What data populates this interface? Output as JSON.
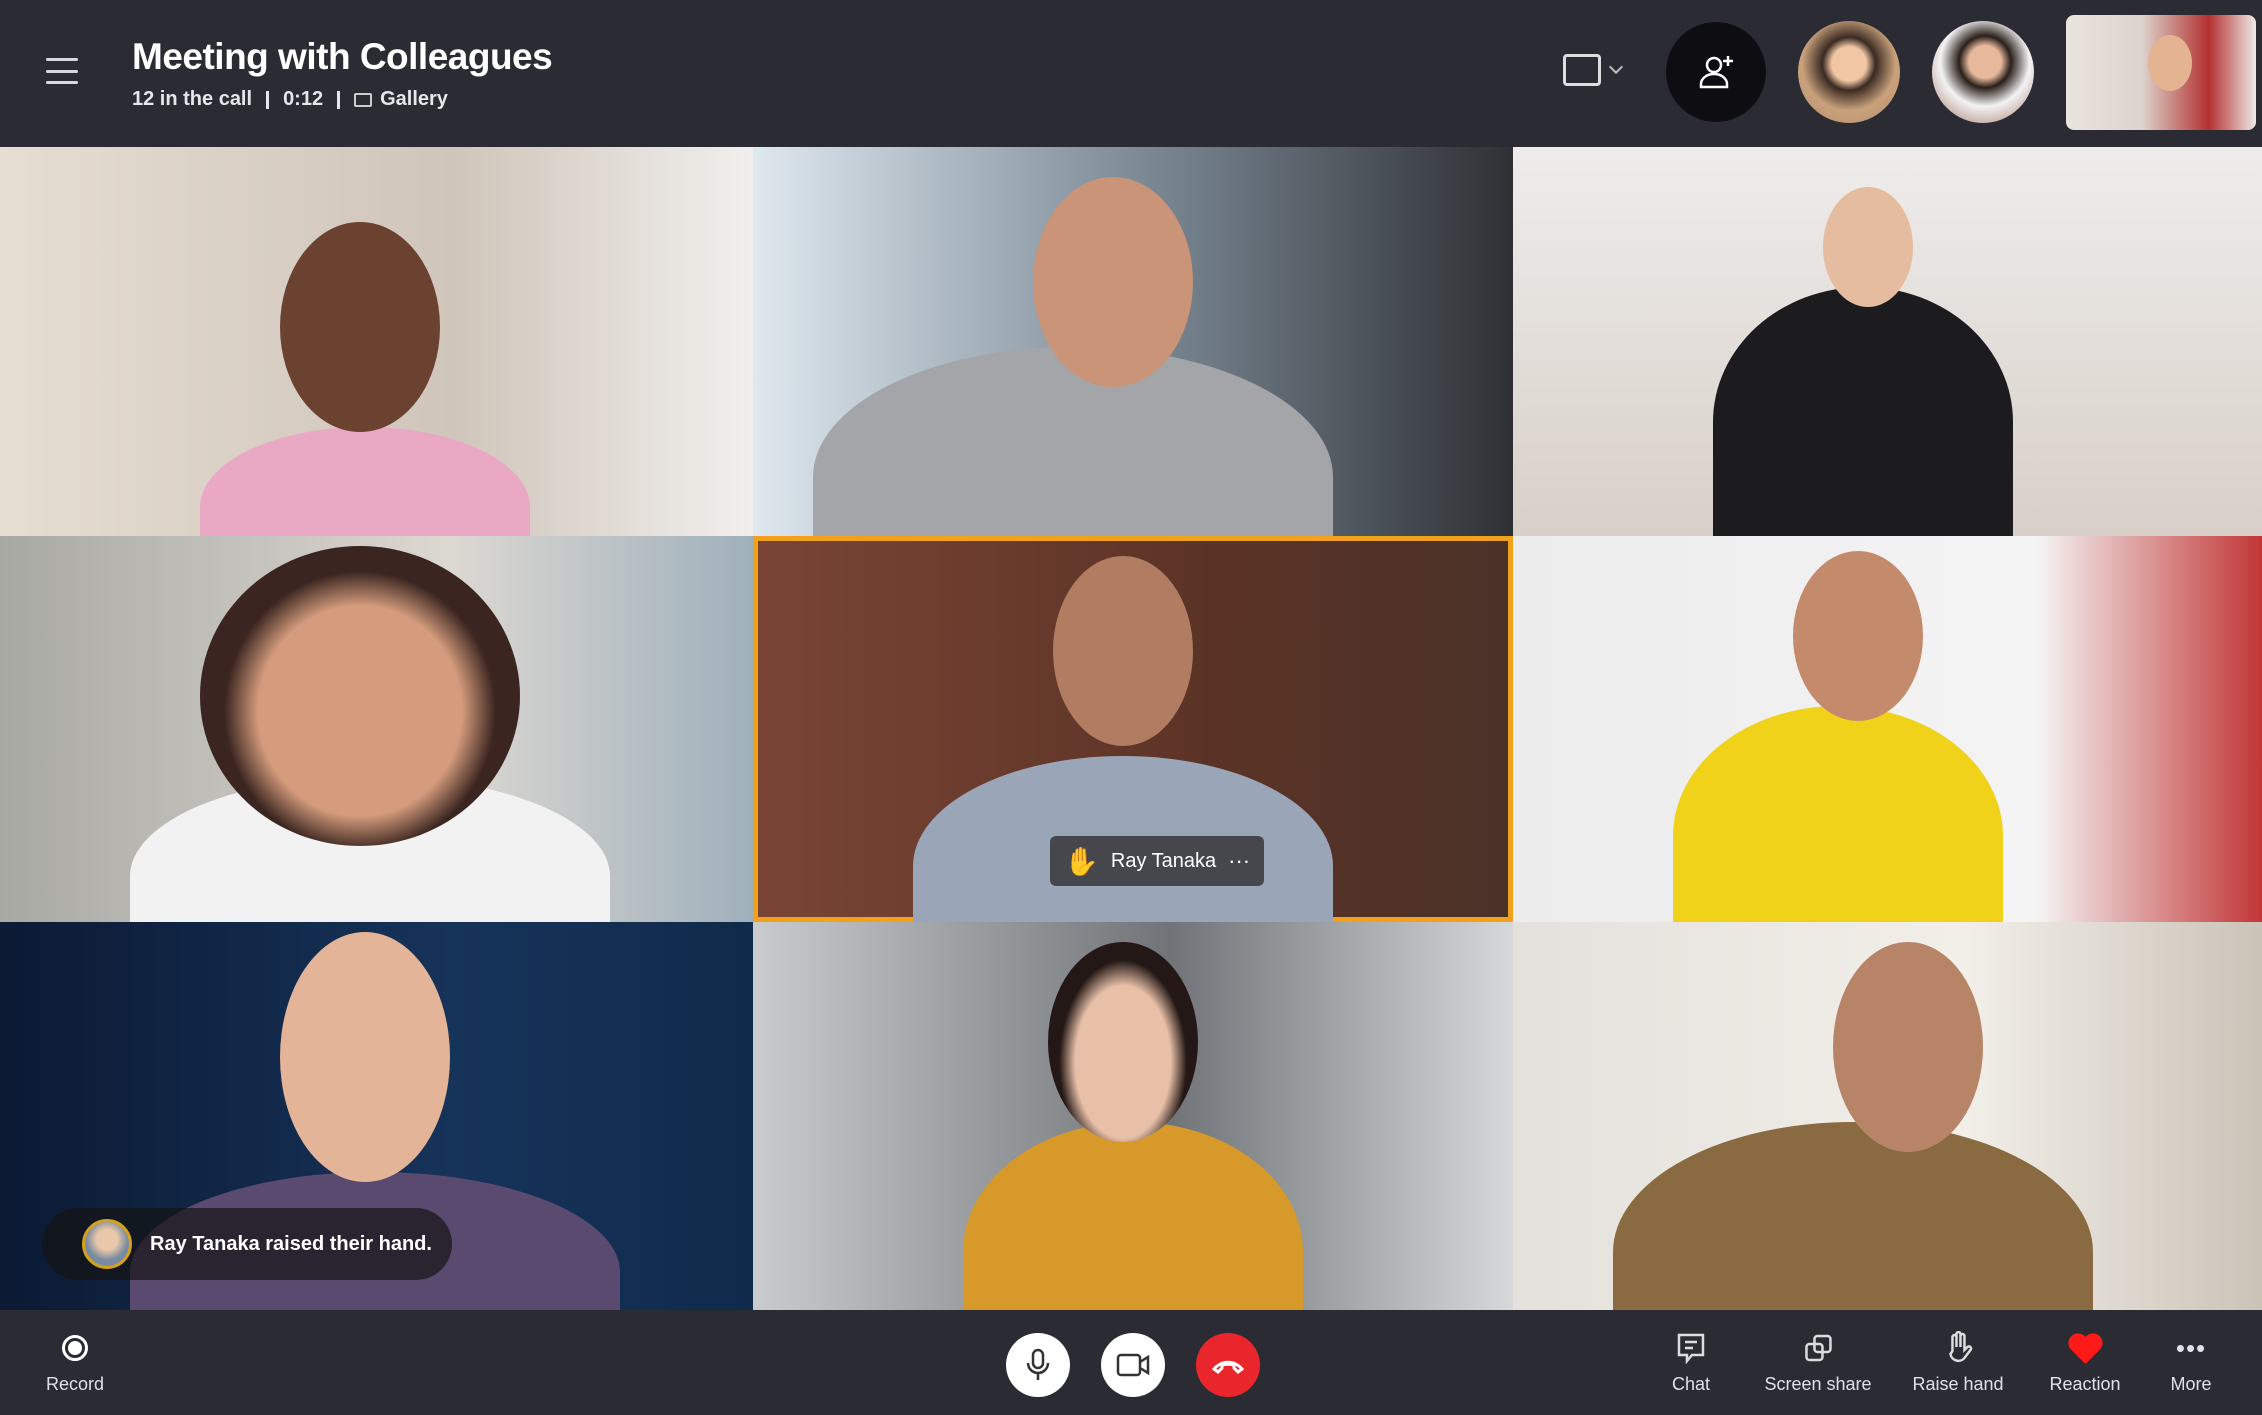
{
  "header": {
    "title": "Meeting with Colleagues",
    "participants": "12 in the call",
    "duration": "0:12",
    "view": "Gallery"
  },
  "tiles": [
    {
      "bg": "#d9cfc4"
    },
    {
      "bg": "#9aa4ad"
    },
    {
      "bg": "#e3dfdb"
    },
    {
      "bg": "#c9c2bb"
    },
    {
      "bg": "#6b3a2c",
      "highlighted": true,
      "name": "Ray Tanaka",
      "raised_hand": true
    },
    {
      "bg": "#e8e6e6"
    },
    {
      "bg": "#0f2340"
    },
    {
      "bg": "#8a8e92"
    },
    {
      "bg": "#cfc9c2"
    }
  ],
  "notification": {
    "text": "Ray Tanaka raised their hand."
  },
  "toolbar": {
    "record": "Record",
    "chat": "Chat",
    "screen_share": "Screen share",
    "raise_hand": "Raise hand",
    "reaction": "Reaction",
    "more": "More"
  },
  "colors": {
    "accent": "#f2a11d",
    "end_call": "#e8262b",
    "reaction": "#ff1a1a",
    "background": "#2b2b33"
  }
}
